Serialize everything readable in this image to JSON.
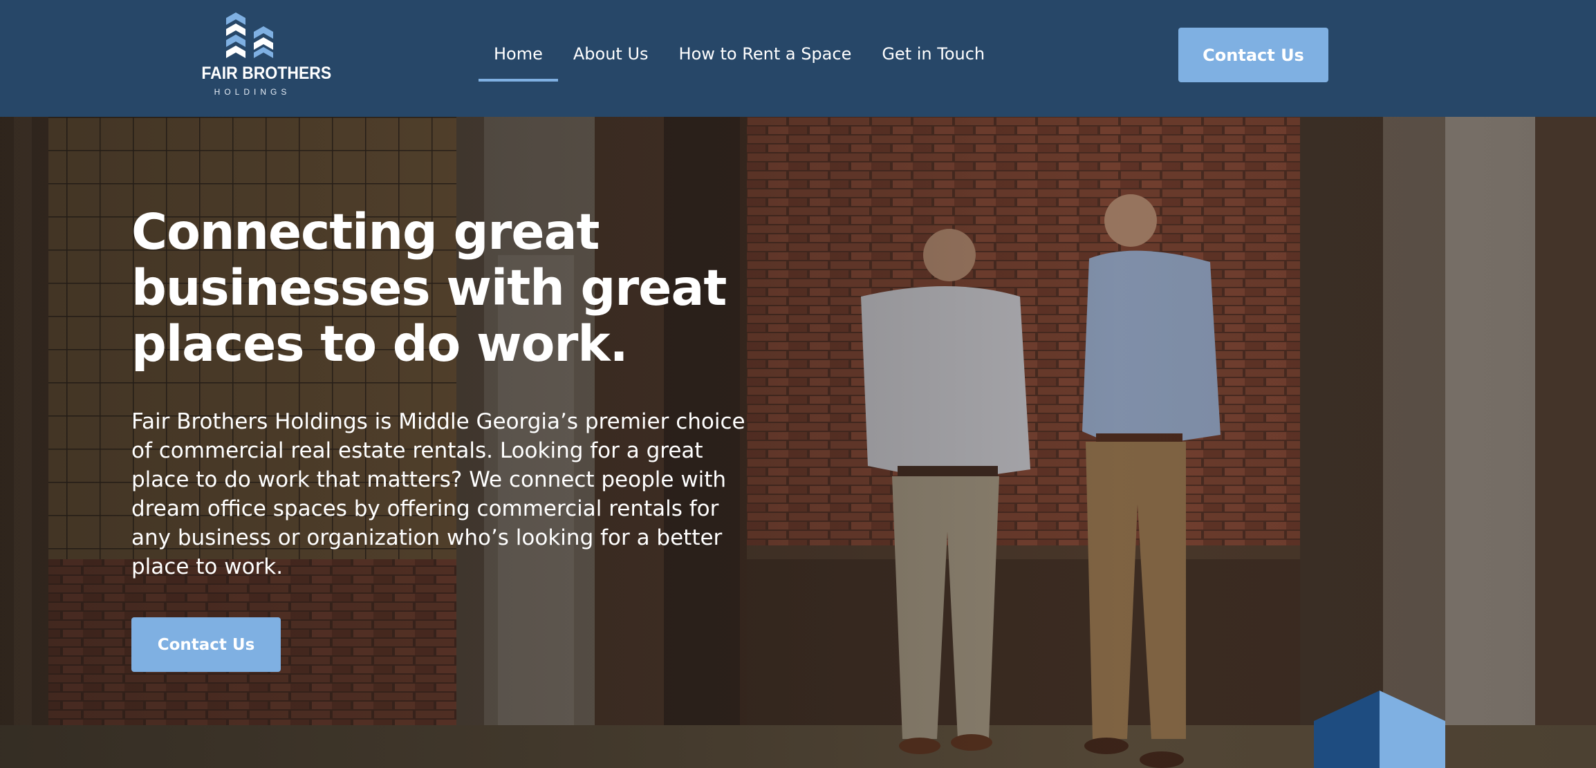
{
  "header": {
    "logo": {
      "name": "FAIR BROTHERS",
      "sub": "HOLDINGS",
      "icon": "building-chevrons-logo-icon"
    },
    "nav": [
      {
        "label": "Home",
        "active": true
      },
      {
        "label": "About Us",
        "active": false
      },
      {
        "label": "How to Rent a Space",
        "active": false
      },
      {
        "label": "Get in Touch",
        "active": false
      }
    ],
    "cta_label": "Contact Us"
  },
  "hero": {
    "title": "Connecting great businesses with great places to do work.",
    "text": "Fair Brothers Holdings is Middle Georgia’s premier choice of commercial real estate rentals. Looking for a great place to do work that matters? We connect people with dream office spaces by offering commercial rentals for any business or organization who’s looking for a better place to work.",
    "cta_label": "Contact Us",
    "image": "two-men-in-front-of-brick-wall-photo"
  },
  "colors": {
    "header_bg": "#274768",
    "accent": "#7fb0e2",
    "text": "#ffffff"
  }
}
